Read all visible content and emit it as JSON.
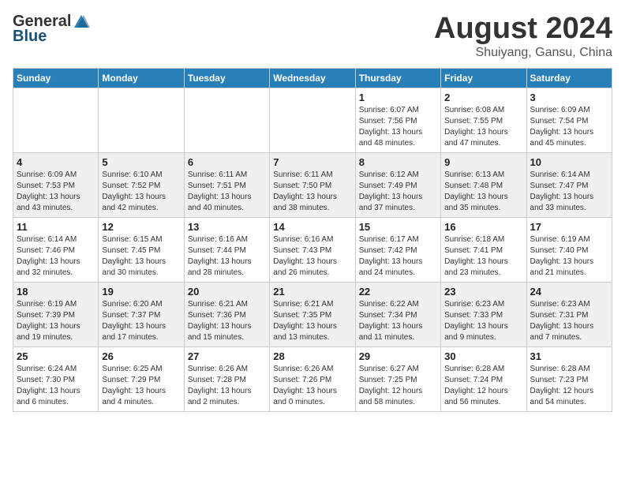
{
  "header": {
    "logo_general": "General",
    "logo_blue": "Blue",
    "month_title": "August 2024",
    "subtitle": "Shuiyang, Gansu, China"
  },
  "days_of_week": [
    "Sunday",
    "Monday",
    "Tuesday",
    "Wednesday",
    "Thursday",
    "Friday",
    "Saturday"
  ],
  "weeks": [
    {
      "days": [
        {
          "number": "",
          "info": ""
        },
        {
          "number": "",
          "info": ""
        },
        {
          "number": "",
          "info": ""
        },
        {
          "number": "",
          "info": ""
        },
        {
          "number": "1",
          "info": "Sunrise: 6:07 AM\nSunset: 7:56 PM\nDaylight: 13 hours\nand 48 minutes."
        },
        {
          "number": "2",
          "info": "Sunrise: 6:08 AM\nSunset: 7:55 PM\nDaylight: 13 hours\nand 47 minutes."
        },
        {
          "number": "3",
          "info": "Sunrise: 6:09 AM\nSunset: 7:54 PM\nDaylight: 13 hours\nand 45 minutes."
        }
      ]
    },
    {
      "days": [
        {
          "number": "4",
          "info": "Sunrise: 6:09 AM\nSunset: 7:53 PM\nDaylight: 13 hours\nand 43 minutes."
        },
        {
          "number": "5",
          "info": "Sunrise: 6:10 AM\nSunset: 7:52 PM\nDaylight: 13 hours\nand 42 minutes."
        },
        {
          "number": "6",
          "info": "Sunrise: 6:11 AM\nSunset: 7:51 PM\nDaylight: 13 hours\nand 40 minutes."
        },
        {
          "number": "7",
          "info": "Sunrise: 6:11 AM\nSunset: 7:50 PM\nDaylight: 13 hours\nand 38 minutes."
        },
        {
          "number": "8",
          "info": "Sunrise: 6:12 AM\nSunset: 7:49 PM\nDaylight: 13 hours\nand 37 minutes."
        },
        {
          "number": "9",
          "info": "Sunrise: 6:13 AM\nSunset: 7:48 PM\nDaylight: 13 hours\nand 35 minutes."
        },
        {
          "number": "10",
          "info": "Sunrise: 6:14 AM\nSunset: 7:47 PM\nDaylight: 13 hours\nand 33 minutes."
        }
      ]
    },
    {
      "days": [
        {
          "number": "11",
          "info": "Sunrise: 6:14 AM\nSunset: 7:46 PM\nDaylight: 13 hours\nand 32 minutes."
        },
        {
          "number": "12",
          "info": "Sunrise: 6:15 AM\nSunset: 7:45 PM\nDaylight: 13 hours\nand 30 minutes."
        },
        {
          "number": "13",
          "info": "Sunrise: 6:16 AM\nSunset: 7:44 PM\nDaylight: 13 hours\nand 28 minutes."
        },
        {
          "number": "14",
          "info": "Sunrise: 6:16 AM\nSunset: 7:43 PM\nDaylight: 13 hours\nand 26 minutes."
        },
        {
          "number": "15",
          "info": "Sunrise: 6:17 AM\nSunset: 7:42 PM\nDaylight: 13 hours\nand 24 minutes."
        },
        {
          "number": "16",
          "info": "Sunrise: 6:18 AM\nSunset: 7:41 PM\nDaylight: 13 hours\nand 23 minutes."
        },
        {
          "number": "17",
          "info": "Sunrise: 6:19 AM\nSunset: 7:40 PM\nDaylight: 13 hours\nand 21 minutes."
        }
      ]
    },
    {
      "days": [
        {
          "number": "18",
          "info": "Sunrise: 6:19 AM\nSunset: 7:39 PM\nDaylight: 13 hours\nand 19 minutes."
        },
        {
          "number": "19",
          "info": "Sunrise: 6:20 AM\nSunset: 7:37 PM\nDaylight: 13 hours\nand 17 minutes."
        },
        {
          "number": "20",
          "info": "Sunrise: 6:21 AM\nSunset: 7:36 PM\nDaylight: 13 hours\nand 15 minutes."
        },
        {
          "number": "21",
          "info": "Sunrise: 6:21 AM\nSunset: 7:35 PM\nDaylight: 13 hours\nand 13 minutes."
        },
        {
          "number": "22",
          "info": "Sunrise: 6:22 AM\nSunset: 7:34 PM\nDaylight: 13 hours\nand 11 minutes."
        },
        {
          "number": "23",
          "info": "Sunrise: 6:23 AM\nSunset: 7:33 PM\nDaylight: 13 hours\nand 9 minutes."
        },
        {
          "number": "24",
          "info": "Sunrise: 6:23 AM\nSunset: 7:31 PM\nDaylight: 13 hours\nand 7 minutes."
        }
      ]
    },
    {
      "days": [
        {
          "number": "25",
          "info": "Sunrise: 6:24 AM\nSunset: 7:30 PM\nDaylight: 13 hours\nand 6 minutes."
        },
        {
          "number": "26",
          "info": "Sunrise: 6:25 AM\nSunset: 7:29 PM\nDaylight: 13 hours\nand 4 minutes."
        },
        {
          "number": "27",
          "info": "Sunrise: 6:26 AM\nSunset: 7:28 PM\nDaylight: 13 hours\nand 2 minutes."
        },
        {
          "number": "28",
          "info": "Sunrise: 6:26 AM\nSunset: 7:26 PM\nDaylight: 13 hours\nand 0 minutes."
        },
        {
          "number": "29",
          "info": "Sunrise: 6:27 AM\nSunset: 7:25 PM\nDaylight: 12 hours\nand 58 minutes."
        },
        {
          "number": "30",
          "info": "Sunrise: 6:28 AM\nSunset: 7:24 PM\nDaylight: 12 hours\nand 56 minutes."
        },
        {
          "number": "31",
          "info": "Sunrise: 6:28 AM\nSunset: 7:23 PM\nDaylight: 12 hours\nand 54 minutes."
        }
      ]
    }
  ]
}
